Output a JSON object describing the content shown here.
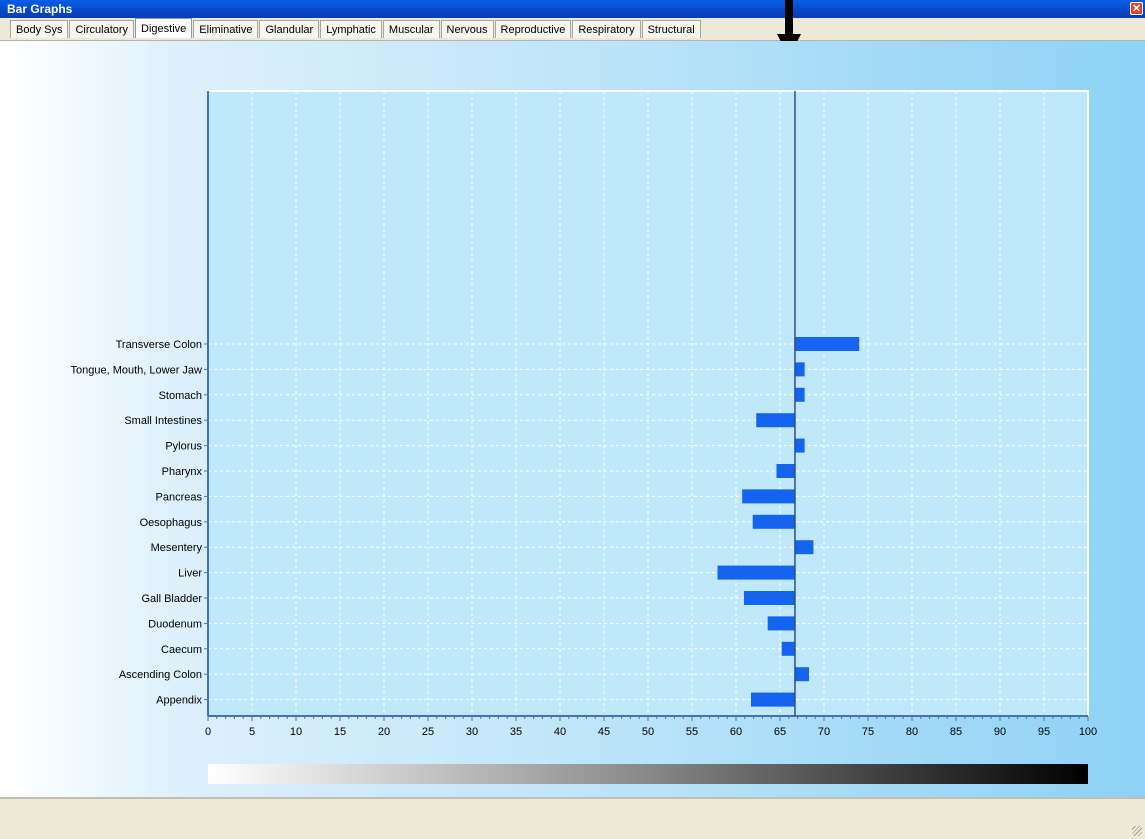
{
  "window": {
    "title": "Bar Graphs",
    "close_icon": "close-icon"
  },
  "tabs": [
    {
      "label": "Body Sys"
    },
    {
      "label": "Circulatory"
    },
    {
      "label": "Digestive",
      "active": true
    },
    {
      "label": "Eliminative"
    },
    {
      "label": "Glandular"
    },
    {
      "label": "Lymphatic"
    },
    {
      "label": "Muscular"
    },
    {
      "label": "Nervous"
    },
    {
      "label": "Reproductive"
    },
    {
      "label": "Respiratory"
    },
    {
      "label": "Structural"
    }
  ],
  "colors": {
    "bar": "#1464f0",
    "axis": "#4a6fb8",
    "reference_line": "#2d4f8c",
    "annotation_arrow": "#000000"
  },
  "chart_data": {
    "type": "bar",
    "orientation": "horizontal",
    "baseline": 66.7,
    "xlim": [
      0,
      100
    ],
    "xticks": [
      0,
      5,
      10,
      15,
      20,
      25,
      30,
      35,
      40,
      45,
      50,
      55,
      60,
      65,
      70,
      75,
      80,
      85,
      90,
      95,
      100
    ],
    "categories": [
      "Transverse Colon",
      "Tongue, Mouth, Lower Jaw",
      "Stomach",
      "Small Intestines",
      "Pylorus",
      "Pharynx",
      "Pancreas",
      "Oesophagus",
      "Mesentery",
      "Liver",
      "Gall Bladder",
      "Duodenum",
      "Caecum",
      "Ascending Colon",
      "Appendix"
    ],
    "values": [
      74,
      67.8,
      67.8,
      62.3,
      67.8,
      64.6,
      60.7,
      61.9,
      68.8,
      57.9,
      60.9,
      63.6,
      65.2,
      68.3,
      61.7
    ],
    "grid": true,
    "legend": "none",
    "gradient_bar": true
  }
}
